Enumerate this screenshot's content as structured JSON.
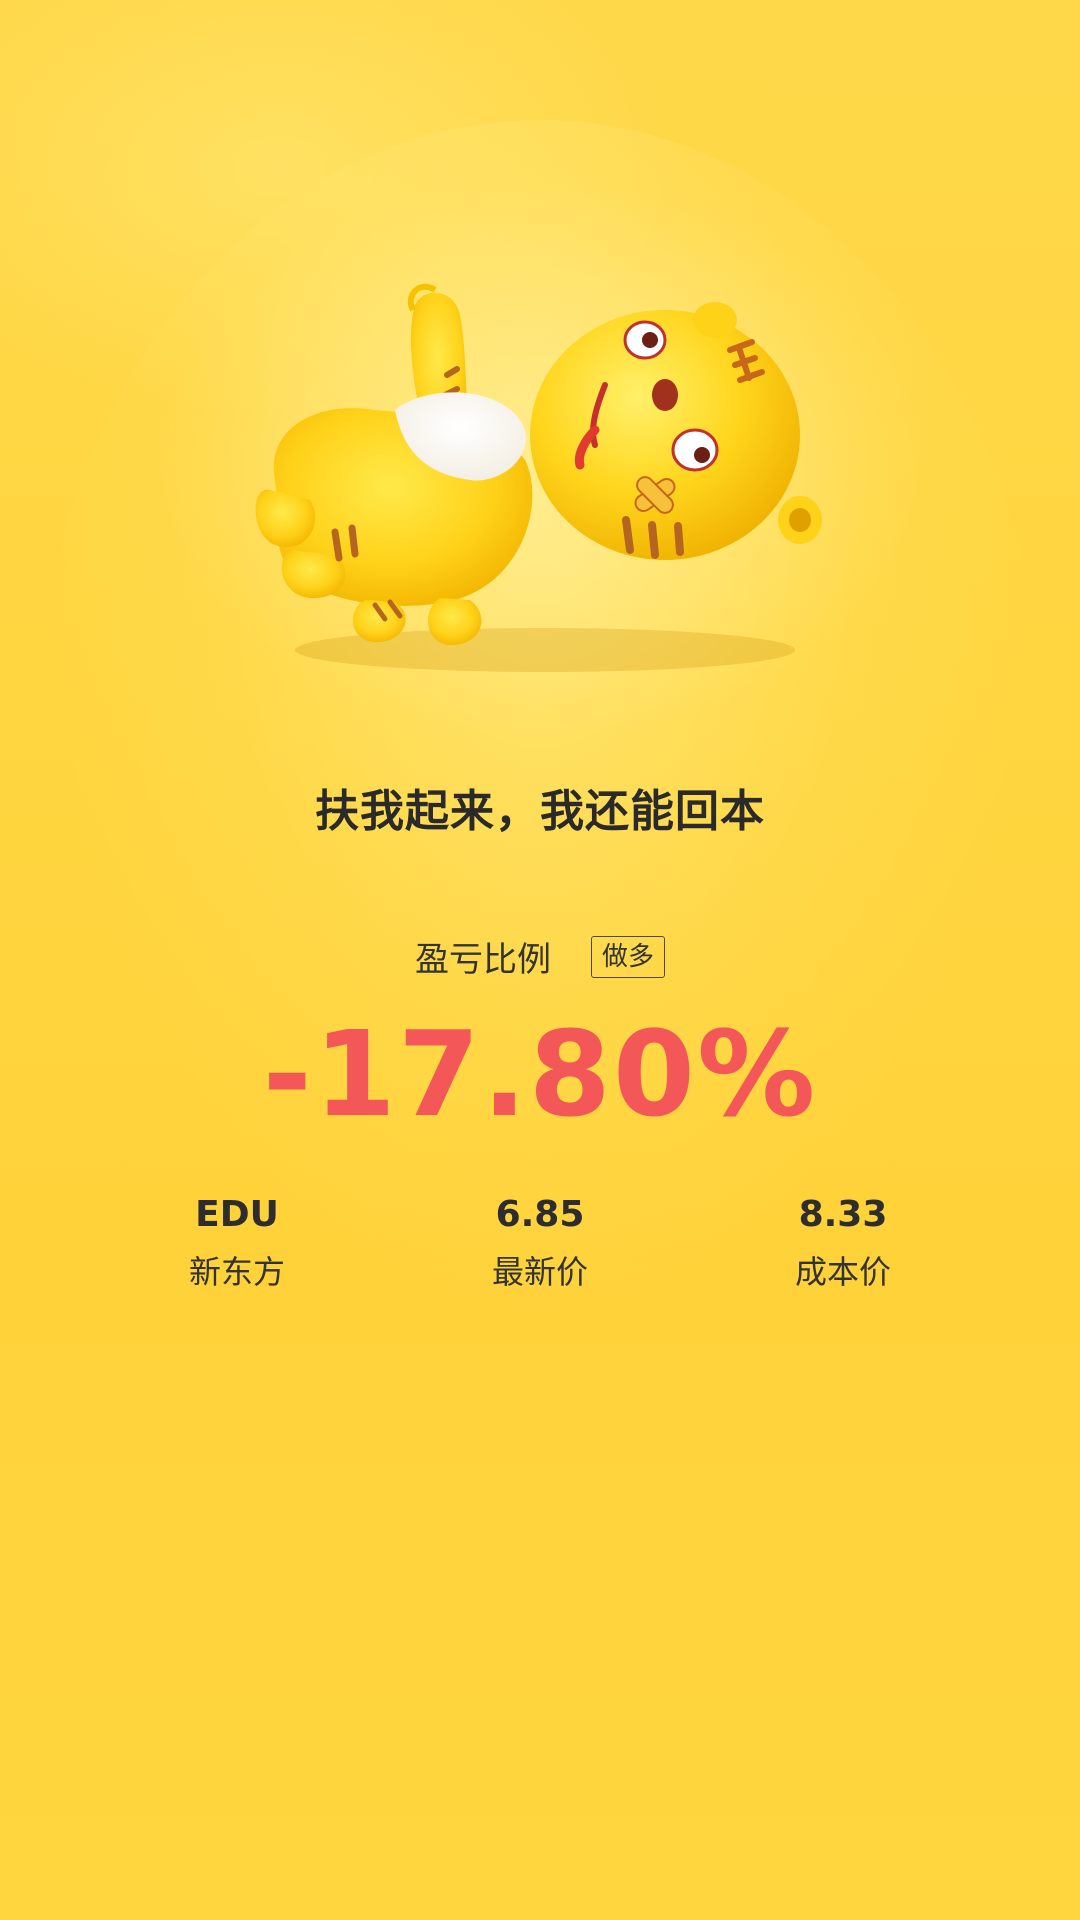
{
  "headline": "扶我起来，我还能回本",
  "ratio": {
    "label": "盈亏比例",
    "direction_tag": "做多",
    "value": "-17.80%"
  },
  "stats": [
    {
      "value": "EDU",
      "label": "新东方"
    },
    {
      "value": "6.85",
      "label": "最新价"
    },
    {
      "value": "8.33",
      "label": "成本价"
    }
  ],
  "mascot": {
    "icon": "tiger-mascot-lying-down"
  },
  "colors": {
    "background": "#ffd640",
    "loss_red": "#f35757",
    "text_dark": "#2a2a2a"
  }
}
